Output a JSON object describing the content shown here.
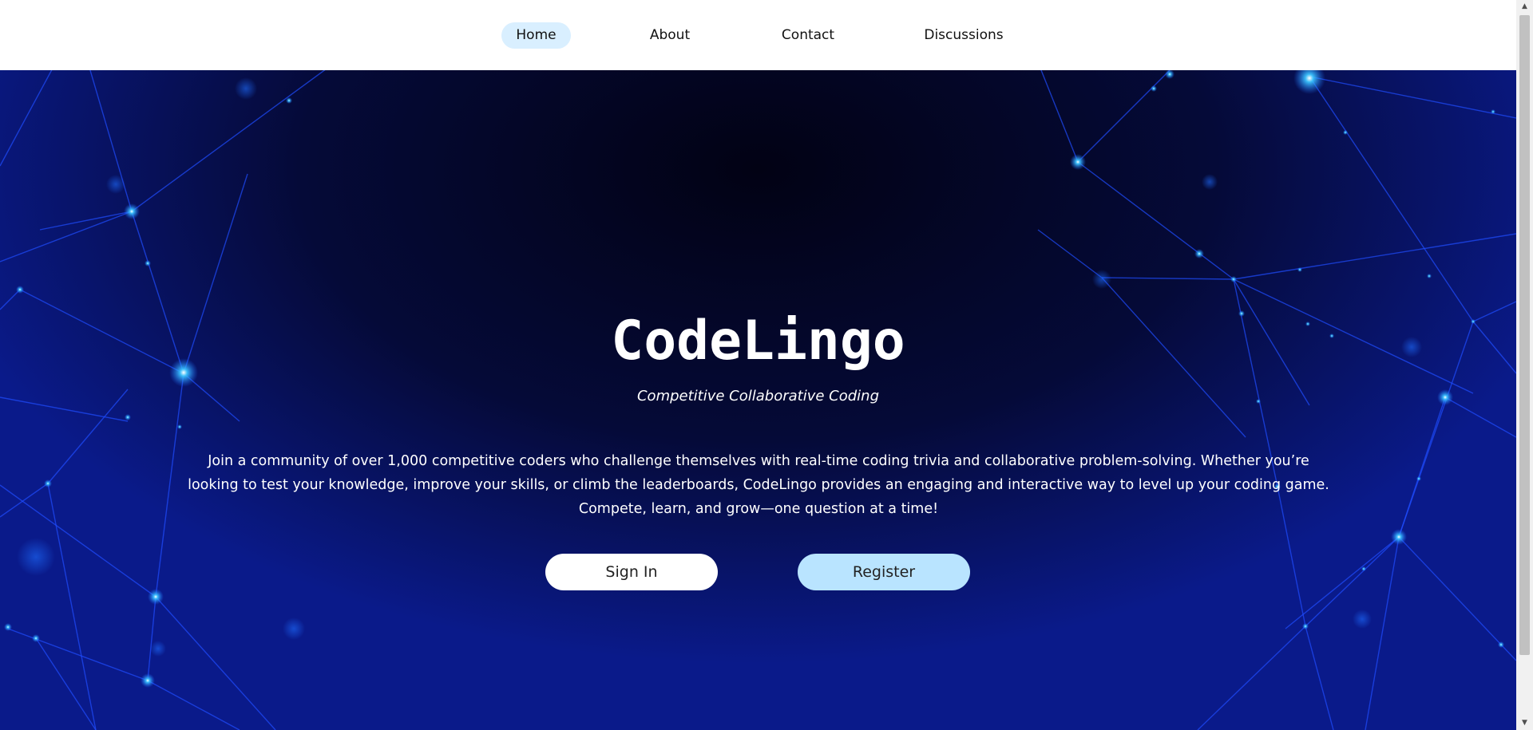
{
  "nav": {
    "items": [
      {
        "label": "Home",
        "active": true
      },
      {
        "label": "About",
        "active": false
      },
      {
        "label": "Contact",
        "active": false
      },
      {
        "label": "Discussions",
        "active": false
      }
    ]
  },
  "hero": {
    "title": "CodeLingo",
    "subtitle": "Competitive Collaborative Coding",
    "description": "Join a community of over 1,000 competitive coders who challenge themselves with real-time coding trivia and collaborative problem-solving. Whether you’re looking to test your knowledge, improve your skills, or climb the leaderboards, CodeLingo provides an engaging and interactive way to level up your coding game. Compete, learn, and grow—one question at a time!",
    "sign_in_label": "Sign In",
    "register_label": "Register"
  },
  "colors": {
    "nav_active": "#d9efff",
    "hero_dark": "#020214",
    "hero_blue": "#0a1a8a",
    "node_glow": "#1aa8ff",
    "register_bg": "#b9e4ff"
  },
  "icons": {
    "scroll_up": "scroll-up-arrow-icon",
    "scroll_down": "scroll-down-arrow-icon"
  }
}
